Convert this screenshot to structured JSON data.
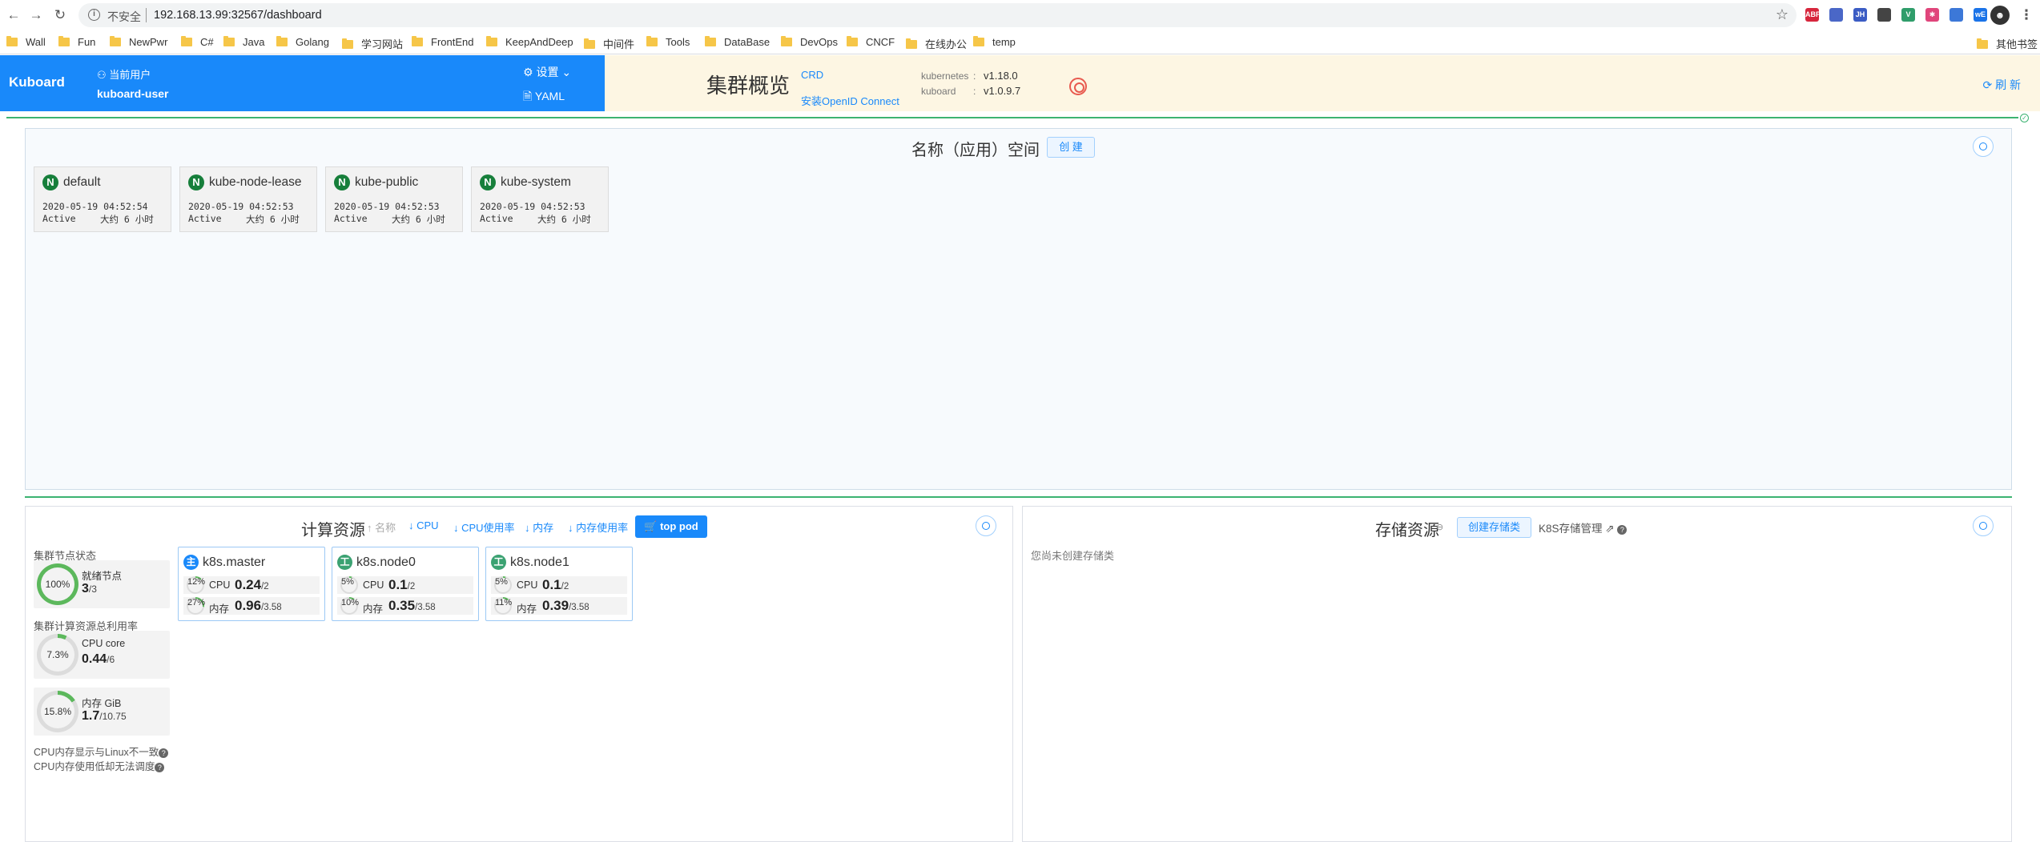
{
  "browser": {
    "insecure_label": "不安全",
    "url": "192.168.13.99:32567/dashboard",
    "bookmarks": [
      "Wall",
      "Fun",
      "NewPwr",
      "C#",
      "Java",
      "Golang",
      "学习网站",
      "FrontEnd",
      "KeepAndDeep",
      "中间件",
      "Tools",
      "DataBase",
      "DevOps",
      "CNCF",
      "在线办公",
      "temp"
    ],
    "other_bookmarks": "其他书签",
    "extensions": [
      {
        "name": "adblock-icon",
        "text": "ABP",
        "color": "#d7263d"
      },
      {
        "name": "calendar-icon",
        "text": "",
        "color": "#4a67c7"
      },
      {
        "name": "jh-icon",
        "text": "JH",
        "color": "#3b5cc4"
      },
      {
        "name": "screen-icon",
        "text": "",
        "color": "#444444"
      },
      {
        "name": "vue-icon",
        "text": "V",
        "color": "#2f9d6a"
      },
      {
        "name": "snowflake-icon",
        "text": "✱",
        "color": "#e0457b"
      },
      {
        "name": "wappalyzer-icon",
        "text": "",
        "color": "#3c78d8"
      },
      {
        "name": "we-icon",
        "text": "wE",
        "color": "#1a73e8"
      }
    ]
  },
  "header": {
    "brand": "Kuboard",
    "user_caption": "当前用户",
    "user_name": "kuboard-user",
    "settings_label": "设置",
    "yaml_label": "YAML",
    "title": "集群概览",
    "crd_label": "CRD",
    "openid_label": "安装OpenID Connect",
    "versions": [
      {
        "key": "kubernetes",
        "value": "v1.18.0"
      },
      {
        "key": "kuboard",
        "value": "v1.0.9.7"
      }
    ],
    "refresh_label": "刷 新",
    "colors": {
      "blue": "#1989fa",
      "cream": "#fdf6e3",
      "green": "#3cb371"
    }
  },
  "namespaces": {
    "title": "名称（应用）空间",
    "create_label": "创 建",
    "items": [
      {
        "badge": "N",
        "name": "default",
        "created": "2020-05-19 04:52:54",
        "status": "Active",
        "age": "大约 6 小时"
      },
      {
        "badge": "N",
        "name": "kube-node-lease",
        "created": "2020-05-19 04:52:53",
        "status": "Active",
        "age": "大约 6 小时"
      },
      {
        "badge": "N",
        "name": "kube-public",
        "created": "2020-05-19 04:52:53",
        "status": "Active",
        "age": "大约 6 小时"
      },
      {
        "badge": "N",
        "name": "kube-system",
        "created": "2020-05-19 04:52:53",
        "status": "Active",
        "age": "大约 6 小时"
      }
    ]
  },
  "compute": {
    "title": "计算资源",
    "sort": {
      "name": "↑ 名称",
      "cpu": "↓ CPU",
      "cpu_usage": "↓ CPU使用率",
      "mem": "↓ 内存",
      "mem_usage": "↓ 内存使用率"
    },
    "top_pod_label": "top pod",
    "node_status_label": "集群节点状态",
    "ready_nodes": {
      "caption": "就绪节点",
      "value": "3",
      "total": "/3",
      "percent": "100%",
      "fraction": 1.0
    },
    "usage_label": "集群计算资源总利用率",
    "cpu_total": {
      "caption": "CPU core",
      "value": "0.44",
      "total": "/6",
      "percent": "7.3%",
      "fraction": 0.073
    },
    "mem_total": {
      "caption": "内存 GiB",
      "value": "1.7",
      "total": "/10.75",
      "percent": "15.8%",
      "fraction": 0.158
    },
    "note1": "CPU内存显示与Linux不一致",
    "note2": "CPU内存使用低却无法调度",
    "nodes": [
      {
        "badge": "主",
        "badge_color": "#1989fa",
        "name": "k8s.master",
        "cpu_pct": "12%",
        "cpu_frac": 0.12,
        "cpu_label": "CPU",
        "cpu_val": "0.24",
        "cpu_total": "/2",
        "mem_pct": "27%",
        "mem_frac": 0.27,
        "mem_label": "内存",
        "mem_val": "0.96",
        "mem_total": "/3.58"
      },
      {
        "badge": "工",
        "badge_color": "#3ba272",
        "name": "k8s.node0",
        "cpu_pct": "5%",
        "cpu_frac": 0.05,
        "cpu_label": "CPU",
        "cpu_val": "0.1",
        "cpu_total": "/2",
        "mem_pct": "10%",
        "mem_frac": 0.1,
        "mem_label": "内存",
        "mem_val": "0.35",
        "mem_total": "/3.58"
      },
      {
        "badge": "工",
        "badge_color": "#3ba272",
        "name": "k8s.node1",
        "cpu_pct": "5%",
        "cpu_frac": 0.05,
        "cpu_label": "CPU",
        "cpu_val": "0.1",
        "cpu_total": "/2",
        "mem_pct": "11%",
        "mem_frac": 0.11,
        "mem_label": "内存",
        "mem_val": "0.39",
        "mem_total": "/3.58"
      }
    ]
  },
  "storage": {
    "title": "存储资源",
    "create_label": "创建存储类",
    "manage_label": "K8S存储管理",
    "empty_text": "您尚未创建存储类"
  }
}
